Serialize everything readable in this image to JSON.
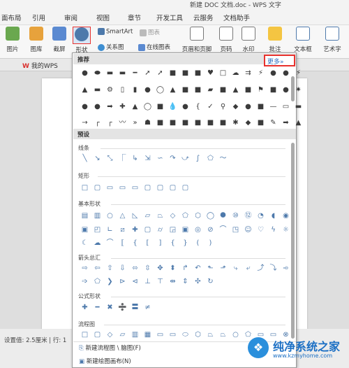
{
  "window": {
    "title": "新建 DOC 文档.doc - WPS 文字"
  },
  "menu": [
    "面布局",
    "引用",
    "审阅",
    "视图",
    "章节",
    "开发工具",
    "云服务",
    "文档助手"
  ],
  "ribbon": {
    "buttons": [
      "图片",
      "图库",
      "截屏",
      "形状"
    ],
    "smartart": "SmartArt",
    "chart": "图表",
    "relation": "关系图",
    "online_chart": "在线图表",
    "header_footer": "页眉和页脚",
    "page_no": "页码",
    "watermark": "水印",
    "comment": "批注",
    "textbox": "文本框",
    "wordart": "艺术字"
  },
  "tabs": {
    "mywps": "我的WPS"
  },
  "panel": {
    "recommended": "推荐",
    "more": "更多»",
    "presets": "预设",
    "lines": "线条",
    "rect": "矩形",
    "basic": "基本形状",
    "arrows": "箭头总汇",
    "formula": "公式形状",
    "flowchart": "流程图",
    "new_flow": "新建流程图 \\ 脑图(F)",
    "new_canvas": "新建绘图画布(N)"
  },
  "status": {
    "text": "设置值: 2.5厘米 | 行: 1"
  },
  "watermark": {
    "brand": "纯净系统之家",
    "url": "www.kzmyhome.com"
  }
}
